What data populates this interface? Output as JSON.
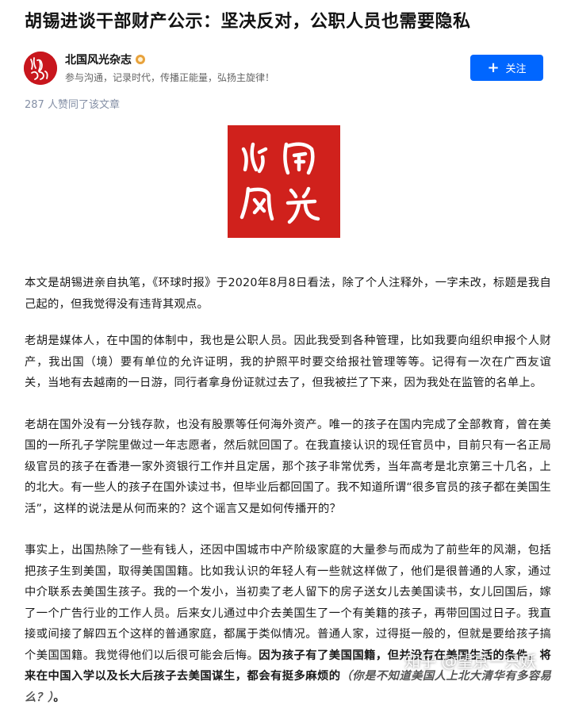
{
  "article": {
    "title": "胡锡进谈干部财产公示：坚决反对，公职人员也需要隐私",
    "votes_text": "287 人赞同了该文章",
    "paragraphs": {
      "p1": "本文是胡锡进亲自执笔，《环球时报》于2020年8月8日看法，除了个人注释外，一字未改，标题是我自己起的，但我觉得没有违背其观点。",
      "p2": "老胡是媒体人，在中国的体制中，我也是公职人员。因此我受到各种管理，比如我要向组织申报个人财产，我出国（境）要有单位的允许证明，我的护照平时要交给报社管理等等。记得有一次在广西友谊关，当地有去越南的一日游，同行者拿身份证就过去了，但我被拦了下来，因为我处在监管的名单上。",
      "p3": "老胡在国外没有一分钱存款，也没有股票等任何海外资产。唯一的孩子在国内完成了全部教育，曾在美国的一所孔子学院里做过一年志愿者，然后就回国了。在我直接认识的现任官员中，目前只有一名正局级官员的孩子在香港一家外资银行工作并且定居，那个孩子非常优秀，当年高考是北京第三十几名，上的北大。有一些人的孩子在国外读过书，但毕业后都回国了。我不知道所谓“很多官员的孩子都在美国生活”，这样的说法是从何而来的？这个谣言又是如何传播开的？",
      "p4_normal": "事实上，出国热除了一些有钱人，还因中国城市中产阶级家庭的大量参与而成为了前些年的风潮，包括把孩子生到美国，取得美国国籍。比如我认识的年轻人有一些就这样做了，他们是很普通的人家，通过中介联系去美国生孩子。我的一个发小，当初卖了老人留下的房子送女儿去美国读书，女儿回国后，嫁了一个广告行业的工作人员。后来女儿通过中介去美国生了一个有美籍的孩子，再带回国过日子。我直接或间接了解四五个这样的普通家庭，都属于类似情况。普通人家，过得挺一般的，但就是要给孩子搞个美国国籍。我觉得他们以后很可能会后悔。",
      "p4_bold": "因为孩子有了美国国籍，但并没有在美国生活的条件，将来在中国入学以及长大后孩子去美国谋生，都会有挺多麻烦的",
      "p4_italic": "（你是不知道美国人上北大清华有多容易么？）",
      "p4_end": "。"
    }
  },
  "author": {
    "name": "北国风光杂志",
    "bio": "参与沟通，记录时代，传播正能量，弘扬主旋律！",
    "avatar_text": "北国风光"
  },
  "follow_button": {
    "label": "关注",
    "icon": "plus-icon"
  },
  "cover_image": {
    "calligraphy": "北国风光",
    "background": "#d0211c"
  },
  "watermark": "知乎 @望京一只妖",
  "colors": {
    "accent": "#0066ff",
    "meta_gray": "#8590a6",
    "brand_red": "#c8161d"
  }
}
